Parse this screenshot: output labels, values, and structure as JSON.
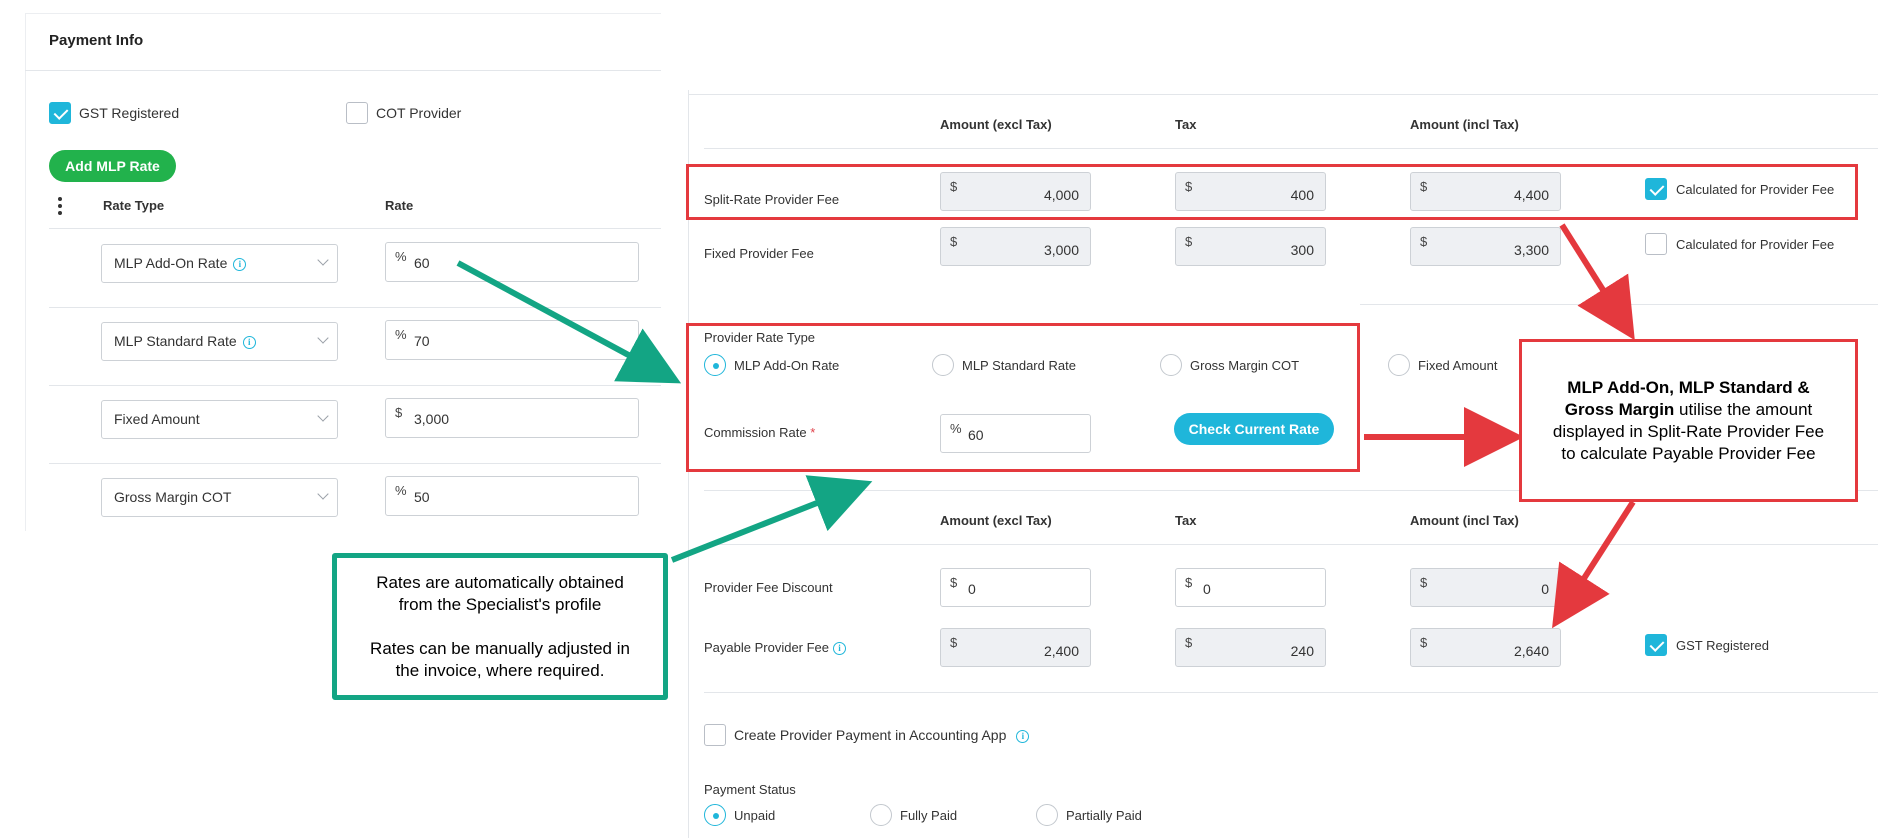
{
  "left_panel": {
    "title": "Payment Info",
    "gst_registered": {
      "label": "GST Registered",
      "checked": true
    },
    "cot_provider": {
      "label": "COT Provider",
      "checked": false
    },
    "add_rate_button": "Add MLP Rate",
    "col_rate_type": "Rate Type",
    "col_rate": "Rate",
    "rows": [
      {
        "type": "MLP Add-On Rate",
        "info": true,
        "symbol": "%",
        "value": "60"
      },
      {
        "type": "MLP Standard Rate",
        "info": true,
        "symbol": "%",
        "value": "70"
      },
      {
        "type": "Fixed Amount",
        "info": false,
        "symbol": "$",
        "value": "3,000"
      },
      {
        "type": "Gross Margin COT",
        "info": false,
        "symbol": "%",
        "value": "50"
      }
    ]
  },
  "fees_table": {
    "col_amount_excl": "Amount (excl Tax)",
    "col_tax": "Tax",
    "col_amount_incl": "Amount (incl Tax)",
    "currency_symbol": "$",
    "split_rate": {
      "label": "Split-Rate Provider Fee",
      "excl": "4,000",
      "tax": "400",
      "incl": "4,400",
      "calc_label": "Calculated for Provider Fee",
      "calc_checked": true
    },
    "fixed": {
      "label": "Fixed Provider Fee",
      "excl": "3,000",
      "tax": "300",
      "incl": "3,300",
      "calc_label": "Calculated for Provider Fee",
      "calc_checked": false
    }
  },
  "provider_rate": {
    "label": "Provider Rate Type",
    "options": [
      "MLP Add-On Rate",
      "MLP Standard Rate",
      "Gross Margin COT",
      "Fixed Amount"
    ],
    "selected": "MLP Add-On Rate",
    "commission_label": "Commission Rate",
    "required_mark": "*",
    "commission_symbol": "%",
    "commission_value": "60",
    "check_button": "Check Current Rate"
  },
  "payable_table": {
    "col_amount_excl": "Amount (excl Tax)",
    "col_tax": "Tax",
    "col_amount_incl": "Amount (incl Tax)",
    "discount": {
      "label": "Provider Fee Discount",
      "excl": "0",
      "tax": "0",
      "incl": "0"
    },
    "payable": {
      "label": "Payable Provider Fee",
      "excl": "2,400",
      "tax": "240",
      "incl": "2,640",
      "gst_label": "GST Registered",
      "gst_checked": true
    },
    "create_payment_label": "Create Provider Payment in Accounting App",
    "create_payment_checked": false
  },
  "payment_status": {
    "label": "Payment Status",
    "options": [
      "Unpaid",
      "Fully Paid",
      "Partially Paid"
    ],
    "selected": "Unpaid"
  },
  "annotations": {
    "green_note_line1": "Rates are automatically obtained",
    "green_note_line2": "from the Specialist's profile",
    "green_note_line3": "Rates can be manually adjusted in",
    "green_note_line4": "the invoice, where required.",
    "red_note_bold1": "MLP Add-On, MLP Standard &",
    "red_note_bold2": "Gross Margin",
    "red_note_rest2": " utilise the amount",
    "red_note_line3": "displayed in Split-Rate Provider Fee",
    "red_note_line4": "to calculate Payable Provider Fee"
  },
  "colors": {
    "accent_blue": "#1fb6da",
    "green_button": "#22b24c",
    "annotation_red": "#e4393e",
    "annotation_green": "#13a584"
  }
}
